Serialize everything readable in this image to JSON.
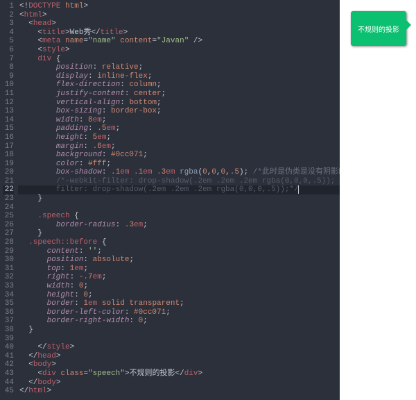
{
  "editor": {
    "active_line": 22,
    "lines": [
      {
        "n": 1,
        "indent": 0,
        "tokens": [
          [
            "punc",
            "<!"
          ],
          [
            "tag",
            "DOCTYPE"
          ],
          [
            "punc",
            " "
          ],
          [
            "attr",
            "html"
          ],
          [
            "punc",
            ">"
          ]
        ]
      },
      {
        "n": 2,
        "indent": 0,
        "tokens": [
          [
            "punc",
            "<"
          ],
          [
            "tag",
            "html"
          ],
          [
            "punc",
            ">"
          ]
        ]
      },
      {
        "n": 3,
        "indent": 1,
        "tokens": [
          [
            "punc",
            "<"
          ],
          [
            "tag",
            "head"
          ],
          [
            "punc",
            ">"
          ]
        ]
      },
      {
        "n": 4,
        "indent": 2,
        "tokens": [
          [
            "punc",
            "<"
          ],
          [
            "tag",
            "title"
          ],
          [
            "punc",
            ">"
          ],
          [
            "text",
            "Web秀"
          ],
          [
            "punc",
            "</"
          ],
          [
            "tag",
            "title"
          ],
          [
            "punc",
            ">"
          ]
        ]
      },
      {
        "n": 5,
        "indent": 2,
        "tokens": [
          [
            "punc",
            "<"
          ],
          [
            "tag",
            "meta"
          ],
          [
            "punc",
            " "
          ],
          [
            "attr",
            "name"
          ],
          [
            "punc",
            "="
          ],
          [
            "str",
            "\"name\""
          ],
          [
            "punc",
            " "
          ],
          [
            "attr",
            "content"
          ],
          [
            "punc",
            "="
          ],
          [
            "str",
            "\"Javan\""
          ],
          [
            "punc",
            " />"
          ]
        ]
      },
      {
        "n": 6,
        "indent": 2,
        "tokens": [
          [
            "punc",
            "<"
          ],
          [
            "tag",
            "style"
          ],
          [
            "punc",
            ">"
          ]
        ]
      },
      {
        "n": 7,
        "indent": 2,
        "tokens": [
          [
            "sel",
            "div"
          ],
          [
            "punc",
            " {"
          ]
        ]
      },
      {
        "n": 8,
        "indent": 4,
        "tokens": [
          [
            "prop",
            "position"
          ],
          [
            "punc",
            ": "
          ],
          [
            "val",
            "relative"
          ],
          [
            "punc",
            ";"
          ]
        ]
      },
      {
        "n": 9,
        "indent": 4,
        "tokens": [
          [
            "prop",
            "display"
          ],
          [
            "punc",
            ": "
          ],
          [
            "val",
            "inline-flex"
          ],
          [
            "punc",
            ";"
          ]
        ]
      },
      {
        "n": 10,
        "indent": 4,
        "tokens": [
          [
            "prop",
            "flex-direction"
          ],
          [
            "punc",
            ": "
          ],
          [
            "val",
            "column"
          ],
          [
            "punc",
            ";"
          ]
        ]
      },
      {
        "n": 11,
        "indent": 4,
        "tokens": [
          [
            "prop",
            "justify-content"
          ],
          [
            "punc",
            ": "
          ],
          [
            "val",
            "center"
          ],
          [
            "punc",
            ";"
          ]
        ]
      },
      {
        "n": 12,
        "indent": 4,
        "tokens": [
          [
            "prop",
            "vertical-align"
          ],
          [
            "punc",
            ": "
          ],
          [
            "val",
            "bottom"
          ],
          [
            "punc",
            ";"
          ]
        ]
      },
      {
        "n": 13,
        "indent": 4,
        "tokens": [
          [
            "prop",
            "box-sizing"
          ],
          [
            "punc",
            ": "
          ],
          [
            "val",
            "border-box"
          ],
          [
            "punc",
            ";"
          ]
        ]
      },
      {
        "n": 14,
        "indent": 4,
        "tokens": [
          [
            "prop",
            "width"
          ],
          [
            "punc",
            ": "
          ],
          [
            "num",
            "8"
          ],
          [
            "unit",
            "em"
          ],
          [
            "punc",
            ";"
          ]
        ]
      },
      {
        "n": 15,
        "indent": 4,
        "tokens": [
          [
            "prop",
            "padding"
          ],
          [
            "punc",
            ": "
          ],
          [
            "num",
            ".5"
          ],
          [
            "unit",
            "em"
          ],
          [
            "punc",
            ";"
          ]
        ]
      },
      {
        "n": 16,
        "indent": 4,
        "tokens": [
          [
            "prop",
            "height"
          ],
          [
            "punc",
            ": "
          ],
          [
            "num",
            "5"
          ],
          [
            "unit",
            "em"
          ],
          [
            "punc",
            ";"
          ]
        ]
      },
      {
        "n": 17,
        "indent": 4,
        "tokens": [
          [
            "prop",
            "margin"
          ],
          [
            "punc",
            ": "
          ],
          [
            "num",
            ".6"
          ],
          [
            "unit",
            "em"
          ],
          [
            "punc",
            ";"
          ]
        ]
      },
      {
        "n": 18,
        "indent": 4,
        "tokens": [
          [
            "prop",
            "background"
          ],
          [
            "punc",
            ": "
          ],
          [
            "hex",
            "#0cc071"
          ],
          [
            "punc",
            ";"
          ]
        ]
      },
      {
        "n": 19,
        "indent": 4,
        "tokens": [
          [
            "prop",
            "color"
          ],
          [
            "punc",
            ": "
          ],
          [
            "hex",
            "#fff"
          ],
          [
            "punc",
            ";"
          ]
        ]
      },
      {
        "n": 20,
        "indent": 4,
        "tokens": [
          [
            "prop",
            "box-shadow"
          ],
          [
            "punc",
            ": "
          ],
          [
            "num",
            ".1"
          ],
          [
            "unit",
            "em "
          ],
          [
            "num",
            ".1"
          ],
          [
            "unit",
            "em "
          ],
          [
            "num",
            ".3"
          ],
          [
            "unit",
            "em "
          ],
          [
            "func",
            "rgba"
          ],
          [
            "punc",
            "("
          ],
          [
            "num",
            "0"
          ],
          [
            "punc",
            ","
          ],
          [
            "num",
            "0"
          ],
          [
            "punc",
            ","
          ],
          [
            "num",
            "0"
          ],
          [
            "punc",
            ","
          ],
          [
            "num",
            ".5"
          ],
          [
            "punc",
            "); "
          ],
          [
            "cmtg",
            "/*此时是伪类是没有阴影的*/"
          ]
        ]
      },
      {
        "n": 21,
        "indent": 4,
        "tokens": [
          [
            "cmt",
            "/*-webkit-filter: drop-shadow(.2em .2em .2em rgba(0,0,0,.5));"
          ]
        ]
      },
      {
        "n": 22,
        "indent": 4,
        "tokens": [
          [
            "cmt",
            "filter: drop-shadow(.2em .2em .2em rgba(0,0,0,.5));*/"
          ],
          [
            "caret",
            ""
          ]
        ]
      },
      {
        "n": 23,
        "indent": 2,
        "tokens": [
          [
            "punc",
            "}"
          ]
        ]
      },
      {
        "n": 24,
        "indent": 0,
        "tokens": []
      },
      {
        "n": 25,
        "indent": 2,
        "tokens": [
          [
            "sel",
            ".speech"
          ],
          [
            "punc",
            " {"
          ]
        ]
      },
      {
        "n": 26,
        "indent": 4,
        "tokens": [
          [
            "prop",
            "border-radius"
          ],
          [
            "punc",
            ": "
          ],
          [
            "num",
            ".3"
          ],
          [
            "unit",
            "em"
          ],
          [
            "punc",
            ";"
          ]
        ]
      },
      {
        "n": 27,
        "indent": 2,
        "tokens": [
          [
            "punc",
            "}"
          ]
        ]
      },
      {
        "n": 28,
        "indent": 1,
        "tokens": [
          [
            "sel",
            ".speech"
          ],
          [
            "kw",
            "::before"
          ],
          [
            "punc",
            " {"
          ]
        ]
      },
      {
        "n": 29,
        "indent": 3,
        "tokens": [
          [
            "prop",
            "content"
          ],
          [
            "punc",
            ": "
          ],
          [
            "str",
            "''"
          ],
          [
            "punc",
            ";"
          ]
        ]
      },
      {
        "n": 30,
        "indent": 3,
        "tokens": [
          [
            "prop",
            "position"
          ],
          [
            "punc",
            ": "
          ],
          [
            "val",
            "absolute"
          ],
          [
            "punc",
            ";"
          ]
        ]
      },
      {
        "n": 31,
        "indent": 3,
        "tokens": [
          [
            "prop",
            "top"
          ],
          [
            "punc",
            ": "
          ],
          [
            "num",
            "1"
          ],
          [
            "unit",
            "em"
          ],
          [
            "punc",
            ";"
          ]
        ]
      },
      {
        "n": 32,
        "indent": 3,
        "tokens": [
          [
            "prop",
            "right"
          ],
          [
            "punc",
            ": "
          ],
          [
            "num",
            "-.7"
          ],
          [
            "unit",
            "em"
          ],
          [
            "punc",
            ";"
          ]
        ]
      },
      {
        "n": 33,
        "indent": 3,
        "tokens": [
          [
            "prop",
            "width"
          ],
          [
            "punc",
            ": "
          ],
          [
            "num",
            "0"
          ],
          [
            "punc",
            ";"
          ]
        ]
      },
      {
        "n": 34,
        "indent": 3,
        "tokens": [
          [
            "prop",
            "height"
          ],
          [
            "punc",
            ": "
          ],
          [
            "num",
            "0"
          ],
          [
            "punc",
            ";"
          ]
        ]
      },
      {
        "n": 35,
        "indent": 3,
        "tokens": [
          [
            "prop",
            "border"
          ],
          [
            "punc",
            ": "
          ],
          [
            "num",
            "1"
          ],
          [
            "unit",
            "em "
          ],
          [
            "val",
            "solid transparent"
          ],
          [
            "punc",
            ";"
          ]
        ]
      },
      {
        "n": 36,
        "indent": 3,
        "tokens": [
          [
            "prop",
            "border-left-color"
          ],
          [
            "punc",
            ": "
          ],
          [
            "hex",
            "#0cc071"
          ],
          [
            "punc",
            ";"
          ]
        ]
      },
      {
        "n": 37,
        "indent": 3,
        "tokens": [
          [
            "prop",
            "border-right-width"
          ],
          [
            "punc",
            ": "
          ],
          [
            "num",
            "0"
          ],
          [
            "punc",
            ";"
          ]
        ]
      },
      {
        "n": 38,
        "indent": 1,
        "tokens": [
          [
            "punc",
            "}"
          ]
        ]
      },
      {
        "n": 39,
        "indent": 0,
        "tokens": []
      },
      {
        "n": 40,
        "indent": 2,
        "tokens": [
          [
            "punc",
            "</"
          ],
          [
            "tag",
            "style"
          ],
          [
            "punc",
            ">"
          ]
        ]
      },
      {
        "n": 41,
        "indent": 1,
        "tokens": [
          [
            "punc",
            "</"
          ],
          [
            "tag",
            "head"
          ],
          [
            "punc",
            ">"
          ]
        ]
      },
      {
        "n": 42,
        "indent": 1,
        "tokens": [
          [
            "punc",
            "<"
          ],
          [
            "tag",
            "body"
          ],
          [
            "punc",
            ">"
          ]
        ]
      },
      {
        "n": 43,
        "indent": 2,
        "tokens": [
          [
            "punc",
            "<"
          ],
          [
            "tag",
            "div"
          ],
          [
            "punc",
            " "
          ],
          [
            "attr",
            "class"
          ],
          [
            "punc",
            "="
          ],
          [
            "str",
            "\"speech\""
          ],
          [
            "punc",
            ">"
          ],
          [
            "text",
            "不规则的投影"
          ],
          [
            "punc",
            "</"
          ],
          [
            "tag",
            "div"
          ],
          [
            "punc",
            ">"
          ]
        ]
      },
      {
        "n": 44,
        "indent": 1,
        "tokens": [
          [
            "punc",
            "</"
          ],
          [
            "tag",
            "body"
          ],
          [
            "punc",
            ">"
          ]
        ]
      },
      {
        "n": 45,
        "indent": 0,
        "tokens": [
          [
            "punc",
            "</"
          ],
          [
            "tag",
            "html"
          ],
          [
            "punc",
            ">"
          ]
        ]
      }
    ]
  },
  "preview": {
    "speech_text": "不规则的投影"
  }
}
